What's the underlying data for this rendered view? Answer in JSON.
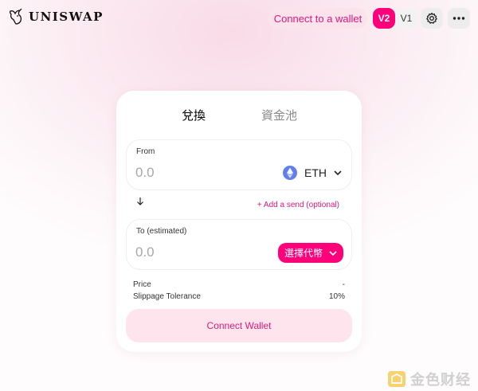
{
  "header": {
    "brand": "UNISWAP",
    "connect_label": "Connect to a wallet",
    "versions": [
      "V2",
      "V1"
    ],
    "active_version": "V2",
    "icons": {
      "settings": "gear-icon",
      "more": "more-dots-icon",
      "logo": "unicorn-icon"
    }
  },
  "card": {
    "tabs": [
      {
        "label": "兌換",
        "active": true
      },
      {
        "label": "資金池",
        "active": false
      }
    ],
    "from": {
      "label": "From",
      "placeholder": "0.0",
      "token": "ETH",
      "token_icon": "ethereum-icon"
    },
    "switch_icon": "arrow-down-icon",
    "add_send_label": "+ Add a send (optional)",
    "to": {
      "label": "To (estimated)",
      "placeholder": "0.0",
      "select_token_label": "選擇代幣"
    },
    "price": {
      "label": "Price",
      "value": "-"
    },
    "slippage": {
      "label": "Slippage Tolerance",
      "value": "10%"
    },
    "connect_wallet_label": "Connect Wallet"
  },
  "watermark": {
    "text": "金色财经"
  },
  "colors": {
    "accent": "#ff007a",
    "accent_text": "#e0167c",
    "accent_soft": "#fde4ed",
    "background_tint": "#f9dbe7"
  }
}
